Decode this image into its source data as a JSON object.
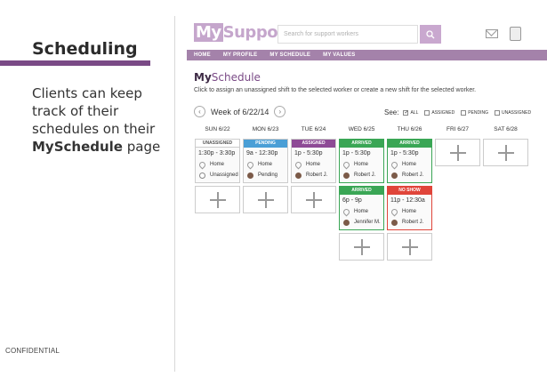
{
  "slide": {
    "title": "Scheduling",
    "body_prefix": "Clients can keep track of their schedules on their",
    "body_bold": "MySchedule",
    "body_suffix": "page",
    "footer": "CONFIDENTIAL"
  },
  "app": {
    "logo_my": "My",
    "logo_rest": "Support",
    "search_placeholder": "Search for support workers",
    "nav": [
      "HOME",
      "MY PROFILE",
      "MY SCHEDULE",
      "MY VALUES"
    ],
    "page_title_bold": "My",
    "page_title_rest": "Schedule",
    "instructions": "Click to assign an unassigned shift to the selected worker or create a new shift for the selected worker.",
    "week_label": "Week of 6/22/14",
    "prev": "‹",
    "next": "›",
    "see_label": "See:",
    "filters": [
      {
        "label": "ALL",
        "checked": "✓"
      },
      {
        "label": "ASSIGNED",
        "checked": ""
      },
      {
        "label": "PENDING",
        "checked": ""
      },
      {
        "label": "UNASSIGNED",
        "checked": ""
      }
    ],
    "days": [
      "SUN 6/22",
      "MON 6/23",
      "TUE 6/24",
      "WED 6/25",
      "THU 6/26",
      "FRI 6/27",
      "SAT 6/28"
    ],
    "shifts": {
      "sun": {
        "status": "UNASSIGNED",
        "color": "#ffffff",
        "time": "1:30p - 3:30p",
        "place": "Home",
        "worker": "Unassigned"
      },
      "mon": {
        "status": "PENDING",
        "color": "#4a9fd6",
        "time": "9a - 12:30p",
        "place": "Home",
        "worker": "Pending"
      },
      "tue": {
        "status": "ASSIGNED",
        "color": "#8e4a96",
        "time": "1p - 5:30p",
        "place": "Home",
        "worker": "Robert J."
      },
      "wed1": {
        "status": "ARRIVED",
        "color": "#3aa655",
        "time": "1p - 5:30p",
        "place": "Home",
        "worker": "Robert J."
      },
      "wed2": {
        "status": "ARRIVED",
        "color": "#3aa655",
        "time": "6p - 9p",
        "place": "Home",
        "worker": "Jennifer M."
      },
      "thu1": {
        "status": "ARRIVED",
        "color": "#3aa655",
        "time": "1p - 5:30p",
        "place": "Home",
        "worker": "Robert J."
      },
      "thu2": {
        "status": "NO SHOW",
        "color": "#e0453a",
        "time": "11p - 12:30a",
        "place": "Home",
        "worker": "Robert J."
      }
    }
  }
}
